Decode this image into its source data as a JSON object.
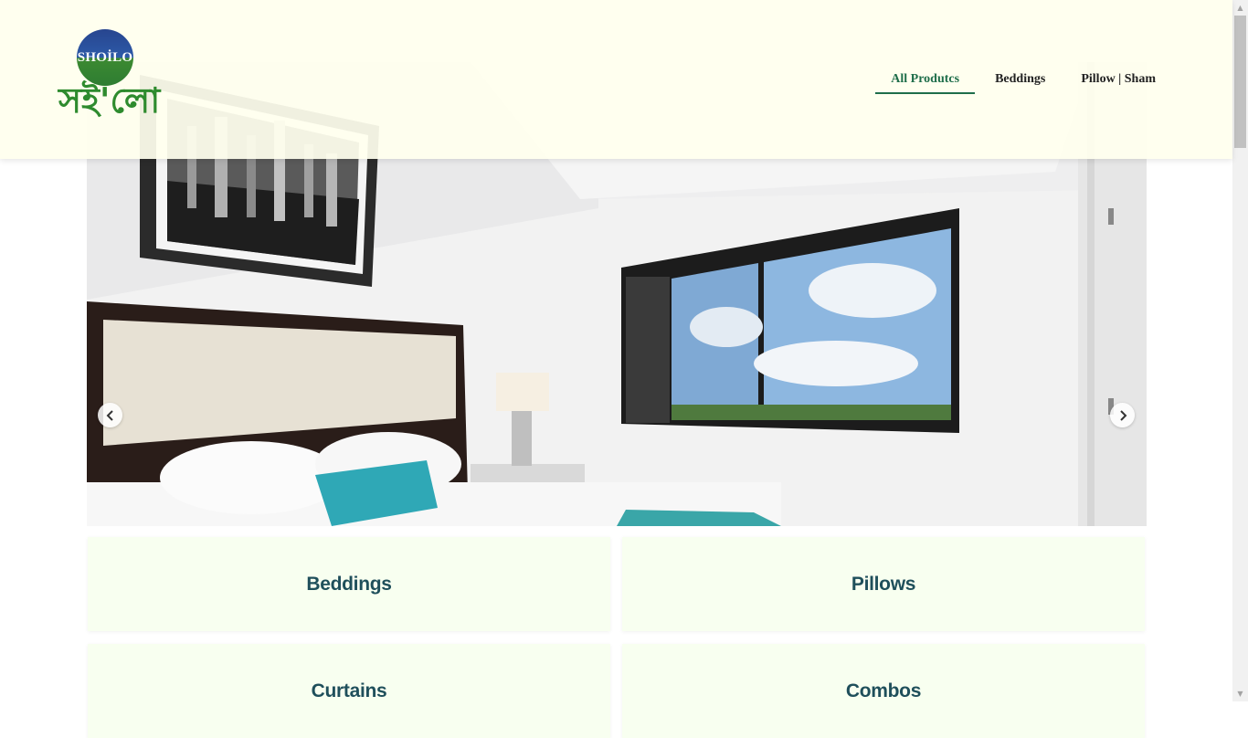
{
  "brand": {
    "logo_latin": "SHOİLO",
    "logo_bengali": "সই'লো"
  },
  "nav": {
    "items": [
      {
        "label": "All Produtcs",
        "active": true
      },
      {
        "label": "Beddings",
        "active": false
      },
      {
        "label": "Pillow | Sham",
        "active": false
      }
    ]
  },
  "hero": {
    "prev_icon": "chevron-left-icon",
    "next_icon": "chevron-right-icon"
  },
  "categories": [
    {
      "label": "Beddings"
    },
    {
      "label": "Pillows"
    },
    {
      "label": "Curtains"
    },
    {
      "label": "Combos"
    }
  ],
  "colors": {
    "header_bg": "#ffffee",
    "active_nav": "#1f6e4a",
    "tile_bg": "#f8fff0",
    "tile_text": "#1f4f5b",
    "logo_green": "#2e8b2e",
    "logo_blue": "#27458f"
  }
}
